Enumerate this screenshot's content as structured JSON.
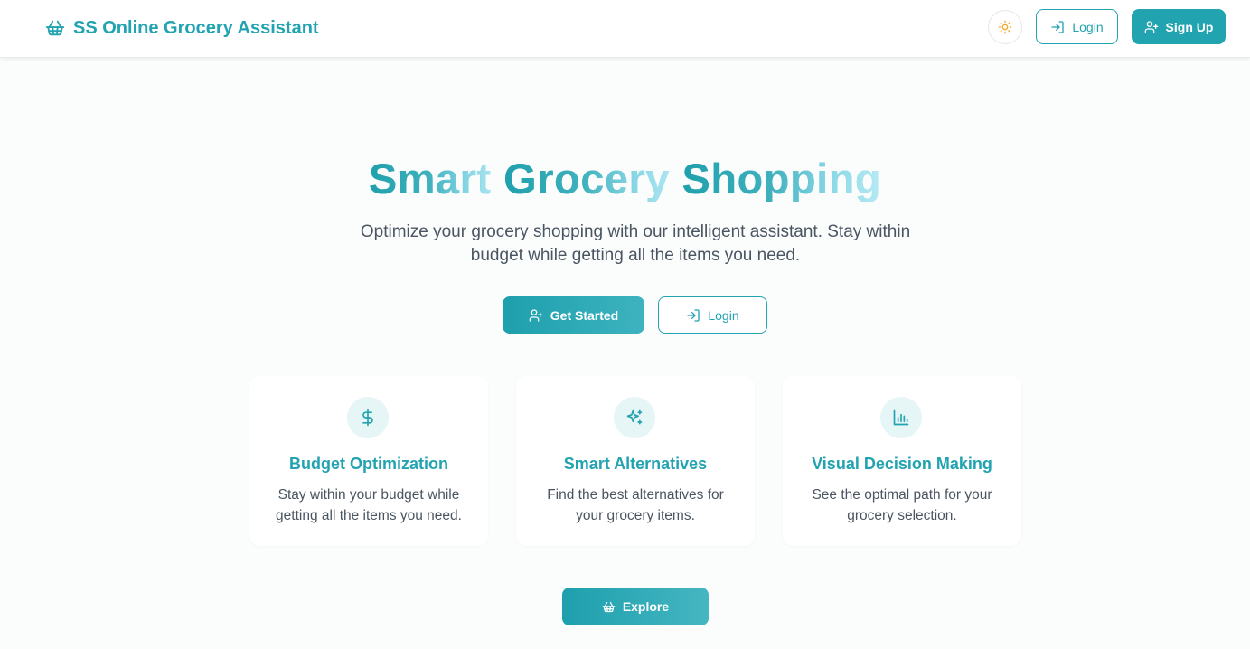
{
  "header": {
    "brand": "SS Online Grocery Assistant",
    "brand_icon": "basket-icon",
    "theme_icon": "sun-icon",
    "login_label": "Login",
    "signup_label": "Sign Up"
  },
  "hero": {
    "title_part1": "Smart ",
    "title_part2": "Grocery ",
    "title_part3": "Shopping",
    "subtitle": "Optimize your grocery shopping with our intelligent assistant. Stay within budget while getting all the items you need.",
    "get_started_label": "Get Started",
    "login_label": "Login"
  },
  "features": [
    {
      "icon": "dollar-icon",
      "title": "Budget Optimization",
      "desc": "Stay within your budget while getting all the items you need."
    },
    {
      "icon": "sparkles-icon",
      "title": "Smart Alternatives",
      "desc": "Find the best alternatives for your grocery items."
    },
    {
      "icon": "bar-chart-icon",
      "title": "Visual Decision Making",
      "desc": "See the optimal path for your grocery selection."
    }
  ],
  "explore_label": "Explore",
  "colors": {
    "accent": "#22a3b1",
    "accent_light": "#e6f5f6",
    "text": "#4a5561",
    "sun": "#f5a623"
  }
}
